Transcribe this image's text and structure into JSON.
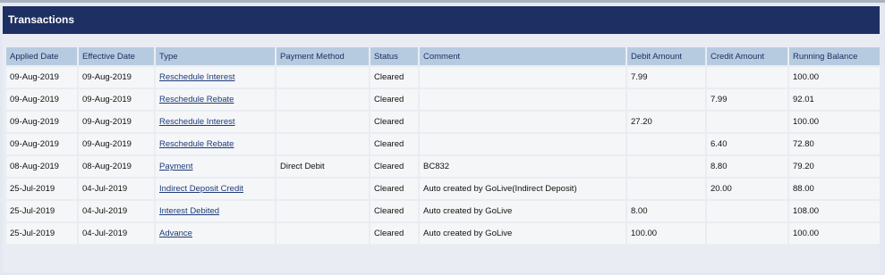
{
  "panel": {
    "title": "Transactions"
  },
  "columns": [
    "Applied Date",
    "Effective Date",
    "Type",
    "Payment Method",
    "Status",
    "Comment",
    "Debit Amount",
    "Credit Amount",
    "Running Balance"
  ],
  "rows": [
    {
      "applied": "09-Aug-2019",
      "effective": "09-Aug-2019",
      "type": "Reschedule Interest",
      "method": "",
      "status": "Cleared",
      "comment": "",
      "debit": "7.99",
      "credit": "",
      "balance": "100.00"
    },
    {
      "applied": "09-Aug-2019",
      "effective": "09-Aug-2019",
      "type": "Reschedule Rebate",
      "method": "",
      "status": "Cleared",
      "comment": "",
      "debit": "",
      "credit": "7.99",
      "balance": "92.01"
    },
    {
      "applied": "09-Aug-2019",
      "effective": "09-Aug-2019",
      "type": "Reschedule Interest",
      "method": "",
      "status": "Cleared",
      "comment": "",
      "debit": "27.20",
      "credit": "",
      "balance": "100.00"
    },
    {
      "applied": "09-Aug-2019",
      "effective": "09-Aug-2019",
      "type": "Reschedule Rebate",
      "method": "",
      "status": "Cleared",
      "comment": "",
      "debit": "",
      "credit": "6.40",
      "balance": "72.80"
    },
    {
      "applied": "08-Aug-2019",
      "effective": "08-Aug-2019",
      "type": "Payment",
      "method": "Direct Debit",
      "status": "Cleared",
      "comment": "BC832",
      "debit": "",
      "credit": "8.80",
      "balance": "79.20"
    },
    {
      "applied": "25-Jul-2019",
      "effective": "04-Jul-2019",
      "type": "Indirect Deposit Credit",
      "method": "",
      "status": "Cleared",
      "comment": "Auto created by GoLive(Indirect Deposit)",
      "debit": "",
      "credit": "20.00",
      "balance": "88.00"
    },
    {
      "applied": "25-Jul-2019",
      "effective": "04-Jul-2019",
      "type": "Interest Debited",
      "method": "",
      "status": "Cleared",
      "comment": "Auto created by GoLive",
      "debit": "8.00",
      "credit": "",
      "balance": "108.00"
    },
    {
      "applied": "25-Jul-2019",
      "effective": "04-Jul-2019",
      "type": "Advance",
      "method": "",
      "status": "Cleared",
      "comment": "Auto created by GoLive",
      "debit": "100.00",
      "credit": "",
      "balance": "100.00"
    }
  ]
}
